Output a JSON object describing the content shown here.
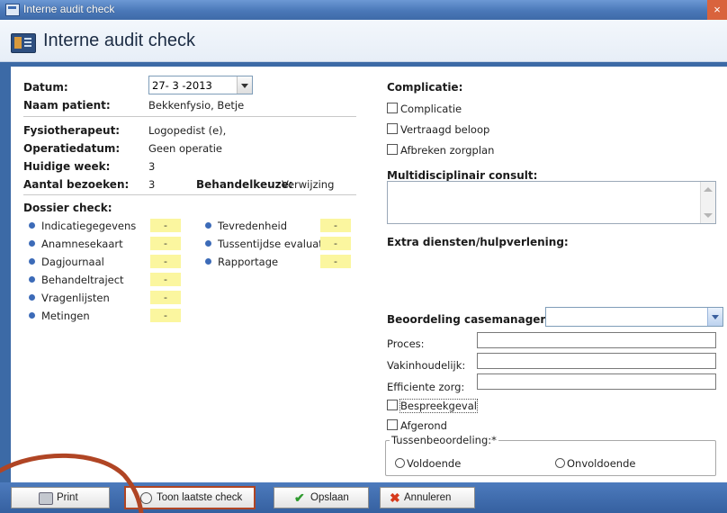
{
  "window": {
    "title": "Interne audit check",
    "close_glyph": "×"
  },
  "header": {
    "title": "Interne audit check",
    "icon": "form-icon"
  },
  "left": {
    "datum_label": "Datum:",
    "datum_value": "27- 3 -2013",
    "naam_label": "Naam patient:",
    "naam_value": "Bekkenfysio, Betje",
    "fysio_label": "Fysiotherapeut:",
    "fysio_value": "Logopedist (e),",
    "opdatum_label": "Operatiedatum:",
    "opdatum_value": "Geen operatie",
    "week_label": "Huidige week:",
    "week_value": "3",
    "bezoeken_label": "Aantal bezoeken:",
    "bezoeken_value": "3",
    "keuze_label": "Behandelkeuze:",
    "keuze_value": "Verwijzing",
    "dossier_label": "Dossier check:",
    "dossier_items_col1": [
      {
        "label": "Indicatiegegevens",
        "flag": "-"
      },
      {
        "label": "Anamnesekaart",
        "flag": "-"
      },
      {
        "label": "Dagjournaal",
        "flag": "-"
      },
      {
        "label": "Behandeltraject",
        "flag": "-"
      },
      {
        "label": "Vragenlijsten",
        "flag": "-"
      },
      {
        "label": "Metingen",
        "flag": "-"
      }
    ],
    "dossier_items_col2": [
      {
        "label": "Tevredenheid",
        "flag": "-"
      },
      {
        "label": "Tussentijdse evaluatie",
        "flag": "-"
      },
      {
        "label": "Rapportage",
        "flag": "-"
      }
    ]
  },
  "right": {
    "complicatie_label": "Complicatie:",
    "checkboxes": [
      "Complicatie",
      "Vertraagd beloop",
      "Afbreken zorgplan"
    ],
    "multi_label": "Multidisciplinair consult:",
    "extra_label": "Extra diensten/hulpverlening:",
    "beoordeling_label": "Beoordeling casemanager:*",
    "beoordeling_value": "",
    "proces_label": "Proces:",
    "vakinhoud_label": "Vakinhoudelijk:",
    "efficiente_label": "Efficiente zorg:",
    "bespreek_label": "Bespreekgeval",
    "afgerond_label": "Afgerond",
    "tussen_label": "Tussenbeoordeling:*",
    "radio_voldoende": "Voldoende",
    "radio_onvoldoende": "Onvoldoende"
  },
  "footer": {
    "print_label": "Print",
    "toon_label": "Toon laatste check",
    "opslaan_label": "Opslaan",
    "annuleren_label": "Annuleren"
  },
  "colors": {
    "accent": "#3c6aa6",
    "flag_bg": "#fbf69f",
    "annotation": "#b04524"
  }
}
